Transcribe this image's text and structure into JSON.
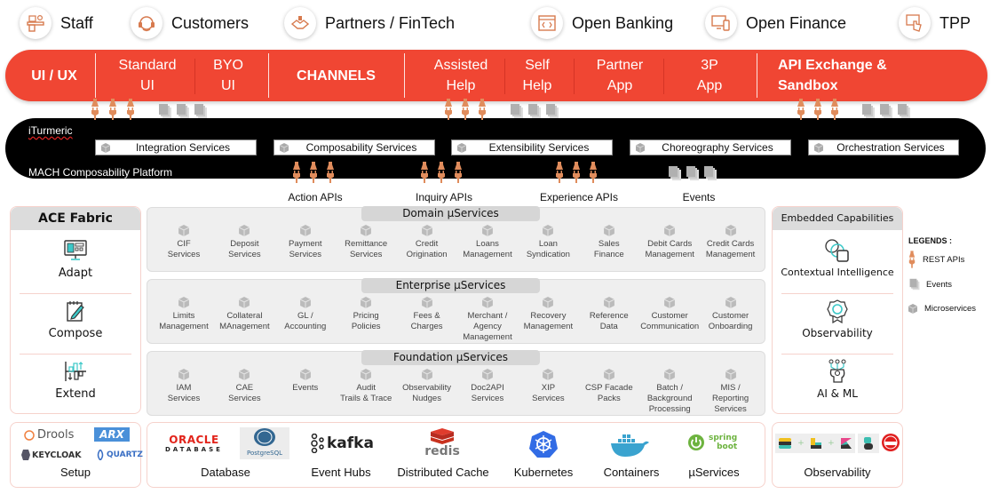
{
  "personas": [
    {
      "label": "Staff",
      "icon": "staff-desk-icon"
    },
    {
      "label": "Customers",
      "icon": "headset-icon"
    },
    {
      "label": "Partners / FinTech",
      "icon": "handshake-icon"
    },
    {
      "label": "Open Banking",
      "icon": "code-window-icon"
    },
    {
      "label": "Open Finance",
      "icon": "devices-icon"
    },
    {
      "label": "TPP",
      "icon": "touch-screen-icon"
    }
  ],
  "channel_bar": {
    "ui_ux": "UI / UX",
    "standard_ui": [
      "Standard",
      "UI"
    ],
    "byo_ui": [
      "BYO",
      "UI"
    ],
    "channels": "CHANNELS",
    "assisted_help": [
      "Assisted",
      "Help"
    ],
    "self_help": [
      "Self",
      "Help"
    ],
    "partner_app": [
      "Partner",
      "App"
    ],
    "third_party_app": [
      "3P",
      "App"
    ],
    "api_exchange": [
      "API Exchange &",
      "Sandbox"
    ]
  },
  "platform": {
    "brand": "iTurmeric",
    "name": "MACH Composability Platform",
    "services": [
      "Integration Services",
      "Composability Services",
      "Extensibility Services",
      "Choreography Services",
      "Orchestration Services"
    ]
  },
  "api_labels": {
    "action": "Action APIs",
    "inquiry": "Inquiry APIs",
    "experience": "Experience APIs",
    "events": "Events"
  },
  "ace_fabric": {
    "title": "ACE Fabric",
    "items": [
      "Adapt",
      "Compose",
      "Extend"
    ]
  },
  "domain_services": {
    "title": "Domain µServices",
    "items": [
      [
        "CIF",
        "Services"
      ],
      [
        "Deposit",
        "Services"
      ],
      [
        "Payment",
        "Services"
      ],
      [
        "Remittance",
        "Services"
      ],
      [
        "Credit",
        "Origination"
      ],
      [
        "Loans",
        "Management"
      ],
      [
        "Loan",
        "Syndication"
      ],
      [
        "Sales",
        "Finance"
      ],
      [
        "Debit Cards",
        "Management"
      ],
      [
        "Credit Cards",
        "Management"
      ]
    ]
  },
  "enterprise_services": {
    "title": "Enterprise µServices",
    "items": [
      [
        "Limits",
        "Management"
      ],
      [
        "Collateral",
        "MAnagement"
      ],
      [
        "GL /",
        "Accounting"
      ],
      [
        "Pricing",
        "Policies"
      ],
      [
        "Fees &",
        "Charges"
      ],
      [
        "Merchant /",
        "Agency",
        "Management"
      ],
      [
        "Recovery",
        "Management"
      ],
      [
        "Reference",
        "Data"
      ],
      [
        "Customer",
        "Communication"
      ],
      [
        "Customer",
        "Onboarding"
      ]
    ]
  },
  "foundation_services": {
    "title": "Foundation µServices",
    "items": [
      [
        "IAM",
        "Services"
      ],
      [
        "CAE",
        "Services"
      ],
      [
        "Events"
      ],
      [
        "Audit",
        "Trails & Trace"
      ],
      [
        "Observability",
        "Nudges"
      ],
      [
        "Doc2API",
        "Services"
      ],
      [
        "XIP",
        "Services"
      ],
      [
        "CSP Facade",
        "Packs"
      ],
      [
        "Batch /",
        "Background",
        "Processing"
      ],
      [
        "MIS /",
        "Reporting",
        "Services"
      ]
    ]
  },
  "embedded_capabilities": {
    "title": "Embedded Capabilities",
    "items": [
      "Contextual Intelligence",
      "Observability",
      "AI & ML"
    ]
  },
  "legend": {
    "title": "LEGENDS :",
    "items": [
      "REST APIs",
      "Events",
      "Microservices"
    ]
  },
  "bottom": {
    "setup": {
      "label": "Setup",
      "logos": [
        "Drools",
        "ARX",
        "KEYCLOAK",
        "QUARTZ"
      ]
    },
    "infra": [
      {
        "label": "Database",
        "logos": [
          "ORACLE",
          "DATABASE",
          "PostgreSQL"
        ]
      },
      {
        "label": "Event Hubs",
        "logos": [
          "kafka"
        ]
      },
      {
        "label": "Distributed Cache",
        "logos": [
          "redis"
        ]
      },
      {
        "label": "Kubernetes",
        "logos": [
          "kubernetes"
        ]
      },
      {
        "label": "Containers",
        "logos": [
          "docker"
        ]
      },
      {
        "label": "µServices",
        "logos": [
          "spring",
          "boot"
        ]
      }
    ],
    "observability": {
      "label": "Observability",
      "logos": [
        "elasticsearch",
        "logstash",
        "kibana",
        "beats",
        "log4j"
      ]
    }
  },
  "colors": {
    "brand_red": "#f04633",
    "plug_orange": "#e08c5c",
    "platform_black": "#000000",
    "panel_grey": "#efefef",
    "accent_teal": "#3cc8c8"
  }
}
